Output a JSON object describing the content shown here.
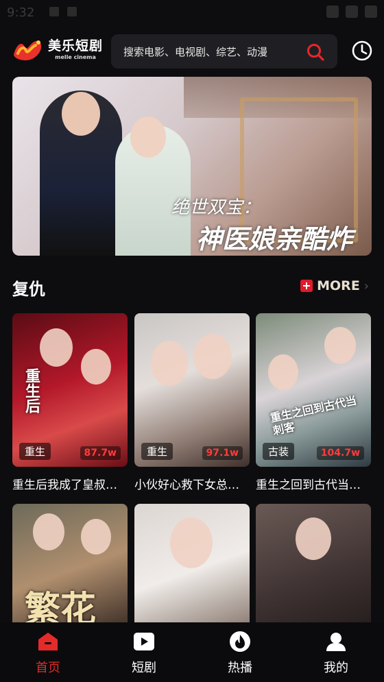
{
  "status_bar": {
    "time": "9:32"
  },
  "header": {
    "logo": {
      "name_cn": "美乐短剧",
      "name_en": "melle cinema"
    },
    "search": {
      "placeholder": "搜索电影、电视剧、综艺、动漫"
    }
  },
  "banner": {
    "title_line1": "绝世双宝：",
    "title_line2": "神医娘亲酷炸了"
  },
  "section": {
    "title": "复仇",
    "more_label": "MORE"
  },
  "cards": [
    {
      "tag": "重生",
      "views": "87.7w",
      "title": "重生后我成了皇叔的掌心宠",
      "poster_text": "重生后"
    },
    {
      "tag": "重生",
      "views": "97.1w",
      "title": "小伙好心救下女总裁后",
      "poster_text": ""
    },
    {
      "tag": "古装",
      "views": "104.7w",
      "title": "重生之回到古代当刺客",
      "poster_text": "重生之回到古代当刺客"
    },
    {
      "tag": "",
      "views": "",
      "title": "",
      "poster_text": "繁花"
    },
    {
      "tag": "",
      "views": "",
      "title": "",
      "poster_text": ""
    },
    {
      "tag": "",
      "views": "",
      "title": "",
      "poster_text": ""
    }
  ],
  "bottom_nav": [
    {
      "label": "首页",
      "icon": "home-icon",
      "active": true
    },
    {
      "label": "短剧",
      "icon": "play-icon",
      "active": false
    },
    {
      "label": "热播",
      "icon": "fire-icon",
      "active": false
    },
    {
      "label": "我的",
      "icon": "user-icon",
      "active": false
    }
  ],
  "colors": {
    "accent": "#e52a2a",
    "background": "#0d0d0f",
    "search_bg": "#1f1f23"
  }
}
